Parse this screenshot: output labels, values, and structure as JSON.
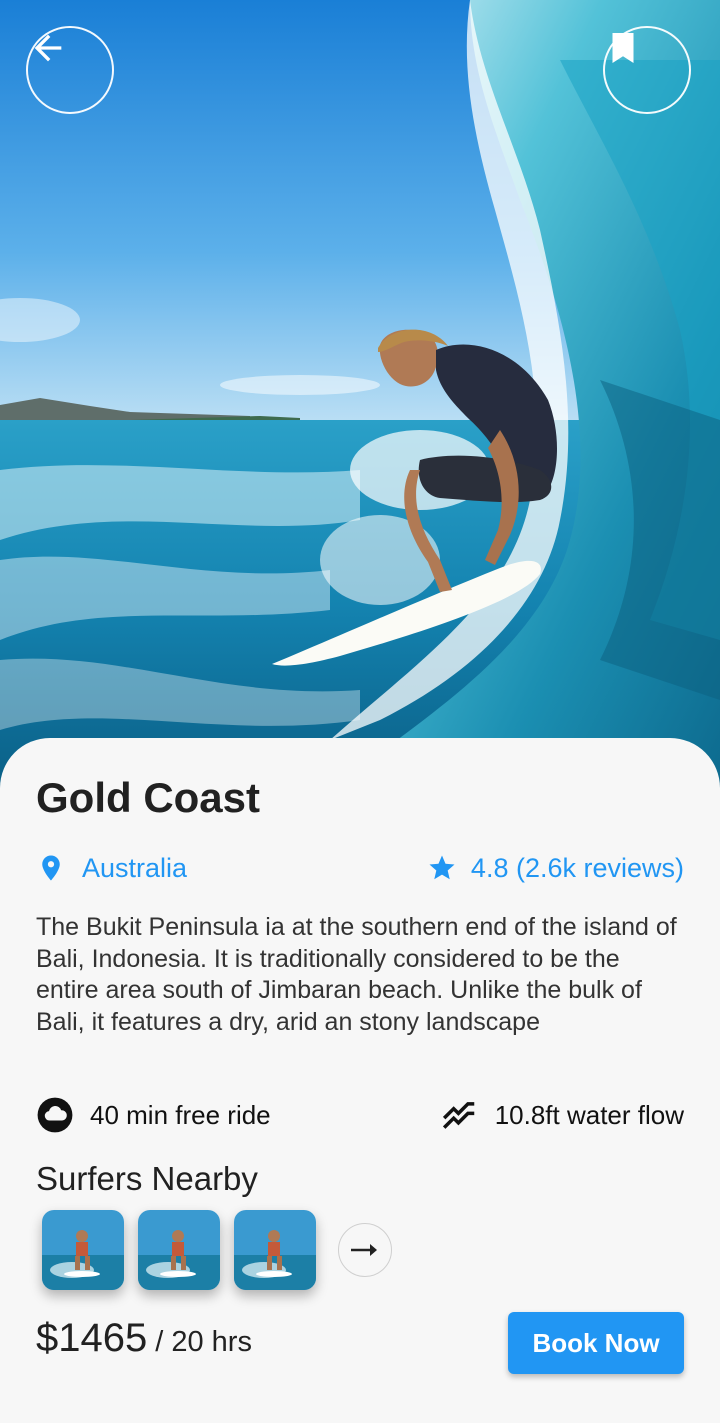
{
  "header": {
    "back_icon": "arrow-back-icon",
    "bookmark_icon": "bookmark-icon"
  },
  "place": {
    "title": "Gold Coast",
    "location": "Australia",
    "location_icon": "location-pin-icon",
    "rating": "4.8 (2.6k reviews)",
    "rating_icon": "star-icon",
    "description": "The Bukit Peninsula ia at the southern end of the island of Bali, Indonesia. It is traditionally considered to be the entire area south of Jimbaran beach. Unlike the bulk of Bali, it features a dry, arid an stony landscape"
  },
  "features": {
    "ride": {
      "label": "40 min free ride",
      "icon": "cloud-icon"
    },
    "water": {
      "label": "10.8ft water flow",
      "icon": "waves-icon"
    }
  },
  "surfers": {
    "title": "Surfers Nearby",
    "count_shown": 3,
    "more_icon": "arrow-right-icon"
  },
  "booking": {
    "price": "$1465",
    "per": "/ 20 hrs",
    "button_label": "Book Now"
  },
  "colors": {
    "accent": "#2196f3",
    "background": "#f7f7f7"
  }
}
